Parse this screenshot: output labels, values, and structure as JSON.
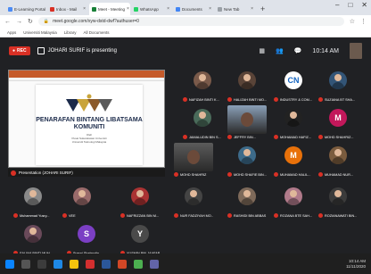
{
  "browser": {
    "tabs": [
      {
        "label": "E-Learning Portal",
        "color": "#4b8bf5"
      },
      {
        "label": "Inbox - Mail",
        "color": "#d93025"
      },
      {
        "label": "Meet - Meeting",
        "color": "#188038"
      },
      {
        "label": "WhatsApp",
        "color": "#25d366"
      },
      {
        "label": "Documents",
        "color": "#4285f4"
      },
      {
        "label": "New Tab",
        "color": "#9aa0a6"
      }
    ],
    "url": "meet.google.com/xyw-dstd-dwf?authuser=0",
    "bookmarks": [
      "Apps",
      "Universiti Malaysia",
      "Library",
      "All Documents"
    ]
  },
  "meet": {
    "rec_label": "REC",
    "presenter": "JOHARI SURIF is presenting",
    "time": "10:14 AM"
  },
  "slide": {
    "title_line1": "PENARAFAN BINTANG LIBATSAMA",
    "title_line2": "KOMUNITI",
    "small1": "Oleh",
    "small2": "Pusat Sukarelawan Universiti",
    "small3": "Universiti Teknologi Malaysia",
    "bar_label": "Presentation (JOHARI SURIF)"
  },
  "participants": [
    {
      "name": "NAFIZAH BINTI K...",
      "kind": "photo",
      "col": "#7a5a4a"
    },
    {
      "name": "HALIZAH BINTI MO...",
      "kind": "photo",
      "col": "#5a4438"
    },
    {
      "name": "INDUSTRY & COM...",
      "kind": "letter",
      "letter": "CN",
      "col": "#ffffff",
      "fg": "#1565c0"
    },
    {
      "name": "SUZIANA BT SHA...",
      "kind": "photo",
      "col": "#335577"
    },
    {
      "name": "JAMALUDIN BIN S...",
      "kind": "photo",
      "col": "#4a6b5a"
    },
    {
      "name": "JEFFRY BIN...",
      "kind": "video",
      "col": "#8aa0b8"
    },
    {
      "name": "MOHAMAD HAFIZ...",
      "kind": "photo",
      "col": "#222222"
    },
    {
      "name": "MOHD SHAHRIZ...",
      "kind": "letter",
      "letter": "M",
      "col": "#c2185b",
      "fg": "#ffffff"
    },
    {
      "name": "MOHD SHAHRIZ",
      "kind": "video",
      "col": "#5b5b5b"
    },
    {
      "name": "MOHD SHAFIE BIN...",
      "kind": "photo",
      "col": "#3d6b8a"
    },
    {
      "name": "MUHAMAD HALIL...",
      "kind": "letter",
      "letter": "M",
      "col": "#e8710a",
      "fg": "#ffffff"
    },
    {
      "name": "MUHAMAD NUR...",
      "kind": "photo",
      "col": "#7b5c3e"
    },
    {
      "name": "Muhammad Yusry...",
      "kind": "photo",
      "col": "#8a8a8a"
    },
    {
      "name": "VEE",
      "kind": "photo",
      "col": "#9a6b6b"
    },
    {
      "name": "NAFRIZZAN BIN M...",
      "kind": "photo",
      "col": "#a33"
    },
    {
      "name": "NUR FADZIYAH MO...",
      "kind": "photo",
      "col": "#444"
    },
    {
      "name": "RASHIDI BIN ABBAS",
      "kind": "photo",
      "col": "#7e6a5a"
    },
    {
      "name": "ROZANA BTE SAH...",
      "kind": "photo",
      "col": "#b07a8a"
    },
    {
      "name": "ROZIANAWATI BIN...",
      "kind": "photo",
      "col": "#3b3b3b"
    },
    {
      "name": "SALINA BINTI MUH...",
      "kind": "photo",
      "col": "#6a4a5a"
    },
    {
      "name": "Syarni Shahrudin",
      "kind": "letter",
      "letter": "S",
      "col": "#7b3fc4",
      "fg": "#ffffff"
    },
    {
      "name": "YUSMIN BIN JAAFAR",
      "kind": "letter",
      "letter": "Y",
      "col": "#4a4a4a",
      "fg": "#ffffff"
    }
  ],
  "taskbar": {
    "time": "10:14 AM",
    "date": "11/11/2020"
  }
}
